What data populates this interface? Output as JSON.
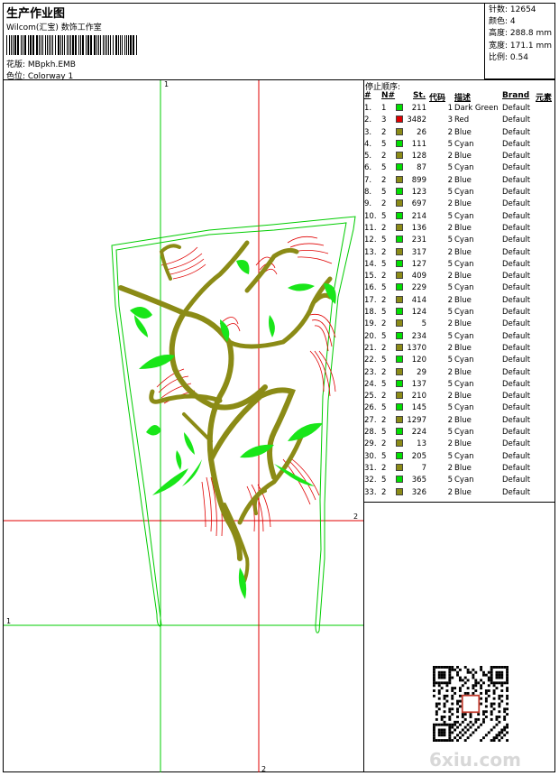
{
  "header": {
    "title": "生产作业图",
    "subtitle": "Wilcom(汇宝) 数饰工作室",
    "design_line": "花版:  MBpkh.EMB",
    "color_line": "色位:  Colorway 1"
  },
  "stats": {
    "stitches": "针数:  12654",
    "colors": "颜色:  4",
    "height": "高度:  288.8 mm",
    "width": "宽度:  171.1 mm",
    "scale": "比例:  0.54"
  },
  "canvas_markers": {
    "top": "1",
    "right": "2",
    "left": "1",
    "bottom": "2"
  },
  "stop_sequence": {
    "title": "停止顺序:",
    "columns": [
      "#",
      "N#",
      "St.",
      "代码",
      "描述",
      "Brand",
      "元素"
    ],
    "rows": [
      {
        "no": "1.",
        "n": "1",
        "color": "#00e000",
        "st": "211",
        "code": "1",
        "desc": "Dark Green",
        "brand": "Default"
      },
      {
        "no": "2.",
        "n": "3",
        "color": "#e00000",
        "st": "3482",
        "code": "3",
        "desc": "Red",
        "brand": "Default"
      },
      {
        "no": "3.",
        "n": "2",
        "color": "#8b8b16",
        "st": "26",
        "code": "2",
        "desc": "Blue",
        "brand": "Default"
      },
      {
        "no": "4.",
        "n": "5",
        "color": "#00e000",
        "st": "111",
        "code": "5",
        "desc": "Cyan",
        "brand": "Default"
      },
      {
        "no": "5.",
        "n": "2",
        "color": "#8b8b16",
        "st": "128",
        "code": "2",
        "desc": "Blue",
        "brand": "Default"
      },
      {
        "no": "6.",
        "n": "5",
        "color": "#00e000",
        "st": "87",
        "code": "5",
        "desc": "Cyan",
        "brand": "Default"
      },
      {
        "no": "7.",
        "n": "2",
        "color": "#8b8b16",
        "st": "899",
        "code": "2",
        "desc": "Blue",
        "brand": "Default"
      },
      {
        "no": "8.",
        "n": "5",
        "color": "#00e000",
        "st": "123",
        "code": "5",
        "desc": "Cyan",
        "brand": "Default"
      },
      {
        "no": "9.",
        "n": "2",
        "color": "#8b8b16",
        "st": "697",
        "code": "2",
        "desc": "Blue",
        "brand": "Default"
      },
      {
        "no": "10.",
        "n": "5",
        "color": "#00e000",
        "st": "214",
        "code": "5",
        "desc": "Cyan",
        "brand": "Default"
      },
      {
        "no": "11.",
        "n": "2",
        "color": "#8b8b16",
        "st": "136",
        "code": "2",
        "desc": "Blue",
        "brand": "Default"
      },
      {
        "no": "12.",
        "n": "5",
        "color": "#00e000",
        "st": "231",
        "code": "5",
        "desc": "Cyan",
        "brand": "Default"
      },
      {
        "no": "13.",
        "n": "2",
        "color": "#8b8b16",
        "st": "317",
        "code": "2",
        "desc": "Blue",
        "brand": "Default"
      },
      {
        "no": "14.",
        "n": "5",
        "color": "#00e000",
        "st": "127",
        "code": "5",
        "desc": "Cyan",
        "brand": "Default"
      },
      {
        "no": "15.",
        "n": "2",
        "color": "#8b8b16",
        "st": "409",
        "code": "2",
        "desc": "Blue",
        "brand": "Default"
      },
      {
        "no": "16.",
        "n": "5",
        "color": "#00e000",
        "st": "229",
        "code": "5",
        "desc": "Cyan",
        "brand": "Default"
      },
      {
        "no": "17.",
        "n": "2",
        "color": "#8b8b16",
        "st": "414",
        "code": "2",
        "desc": "Blue",
        "brand": "Default"
      },
      {
        "no": "18.",
        "n": "5",
        "color": "#00e000",
        "st": "124",
        "code": "5",
        "desc": "Cyan",
        "brand": "Default"
      },
      {
        "no": "19.",
        "n": "2",
        "color": "#8b8b16",
        "st": "5",
        "code": "2",
        "desc": "Blue",
        "brand": "Default"
      },
      {
        "no": "20.",
        "n": "5",
        "color": "#00e000",
        "st": "234",
        "code": "5",
        "desc": "Cyan",
        "brand": "Default"
      },
      {
        "no": "21.",
        "n": "2",
        "color": "#8b8b16",
        "st": "1370",
        "code": "2",
        "desc": "Blue",
        "brand": "Default"
      },
      {
        "no": "22.",
        "n": "5",
        "color": "#00e000",
        "st": "120",
        "code": "5",
        "desc": "Cyan",
        "brand": "Default"
      },
      {
        "no": "23.",
        "n": "2",
        "color": "#8b8b16",
        "st": "29",
        "code": "2",
        "desc": "Blue",
        "brand": "Default"
      },
      {
        "no": "24.",
        "n": "5",
        "color": "#00e000",
        "st": "137",
        "code": "5",
        "desc": "Cyan",
        "brand": "Default"
      },
      {
        "no": "25.",
        "n": "2",
        "color": "#8b8b16",
        "st": "210",
        "code": "2",
        "desc": "Blue",
        "brand": "Default"
      },
      {
        "no": "26.",
        "n": "5",
        "color": "#00e000",
        "st": "145",
        "code": "5",
        "desc": "Cyan",
        "brand": "Default"
      },
      {
        "no": "27.",
        "n": "2",
        "color": "#8b8b16",
        "st": "1297",
        "code": "2",
        "desc": "Blue",
        "brand": "Default"
      },
      {
        "no": "28.",
        "n": "5",
        "color": "#00e000",
        "st": "224",
        "code": "5",
        "desc": "Cyan",
        "brand": "Default"
      },
      {
        "no": "29.",
        "n": "2",
        "color": "#8b8b16",
        "st": "13",
        "code": "2",
        "desc": "Blue",
        "brand": "Default"
      },
      {
        "no": "30.",
        "n": "5",
        "color": "#00e000",
        "st": "205",
        "code": "5",
        "desc": "Cyan",
        "brand": "Default"
      },
      {
        "no": "31.",
        "n": "2",
        "color": "#8b8b16",
        "st": "7",
        "code": "2",
        "desc": "Blue",
        "brand": "Default"
      },
      {
        "no": "32.",
        "n": "5",
        "color": "#00e000",
        "st": "365",
        "code": "5",
        "desc": "Cyan",
        "brand": "Default"
      },
      {
        "no": "33.",
        "n": "2",
        "color": "#8b8b16",
        "st": "326",
        "code": "2",
        "desc": "Blue",
        "brand": "Default"
      }
    ]
  },
  "watermark": "6xiu.com",
  "colors": {
    "guide_green": "#00cc00",
    "guide_red": "#e00000",
    "stem": "#8b8b16",
    "leaf": "#19e619",
    "petal_red": "#e00000"
  }
}
